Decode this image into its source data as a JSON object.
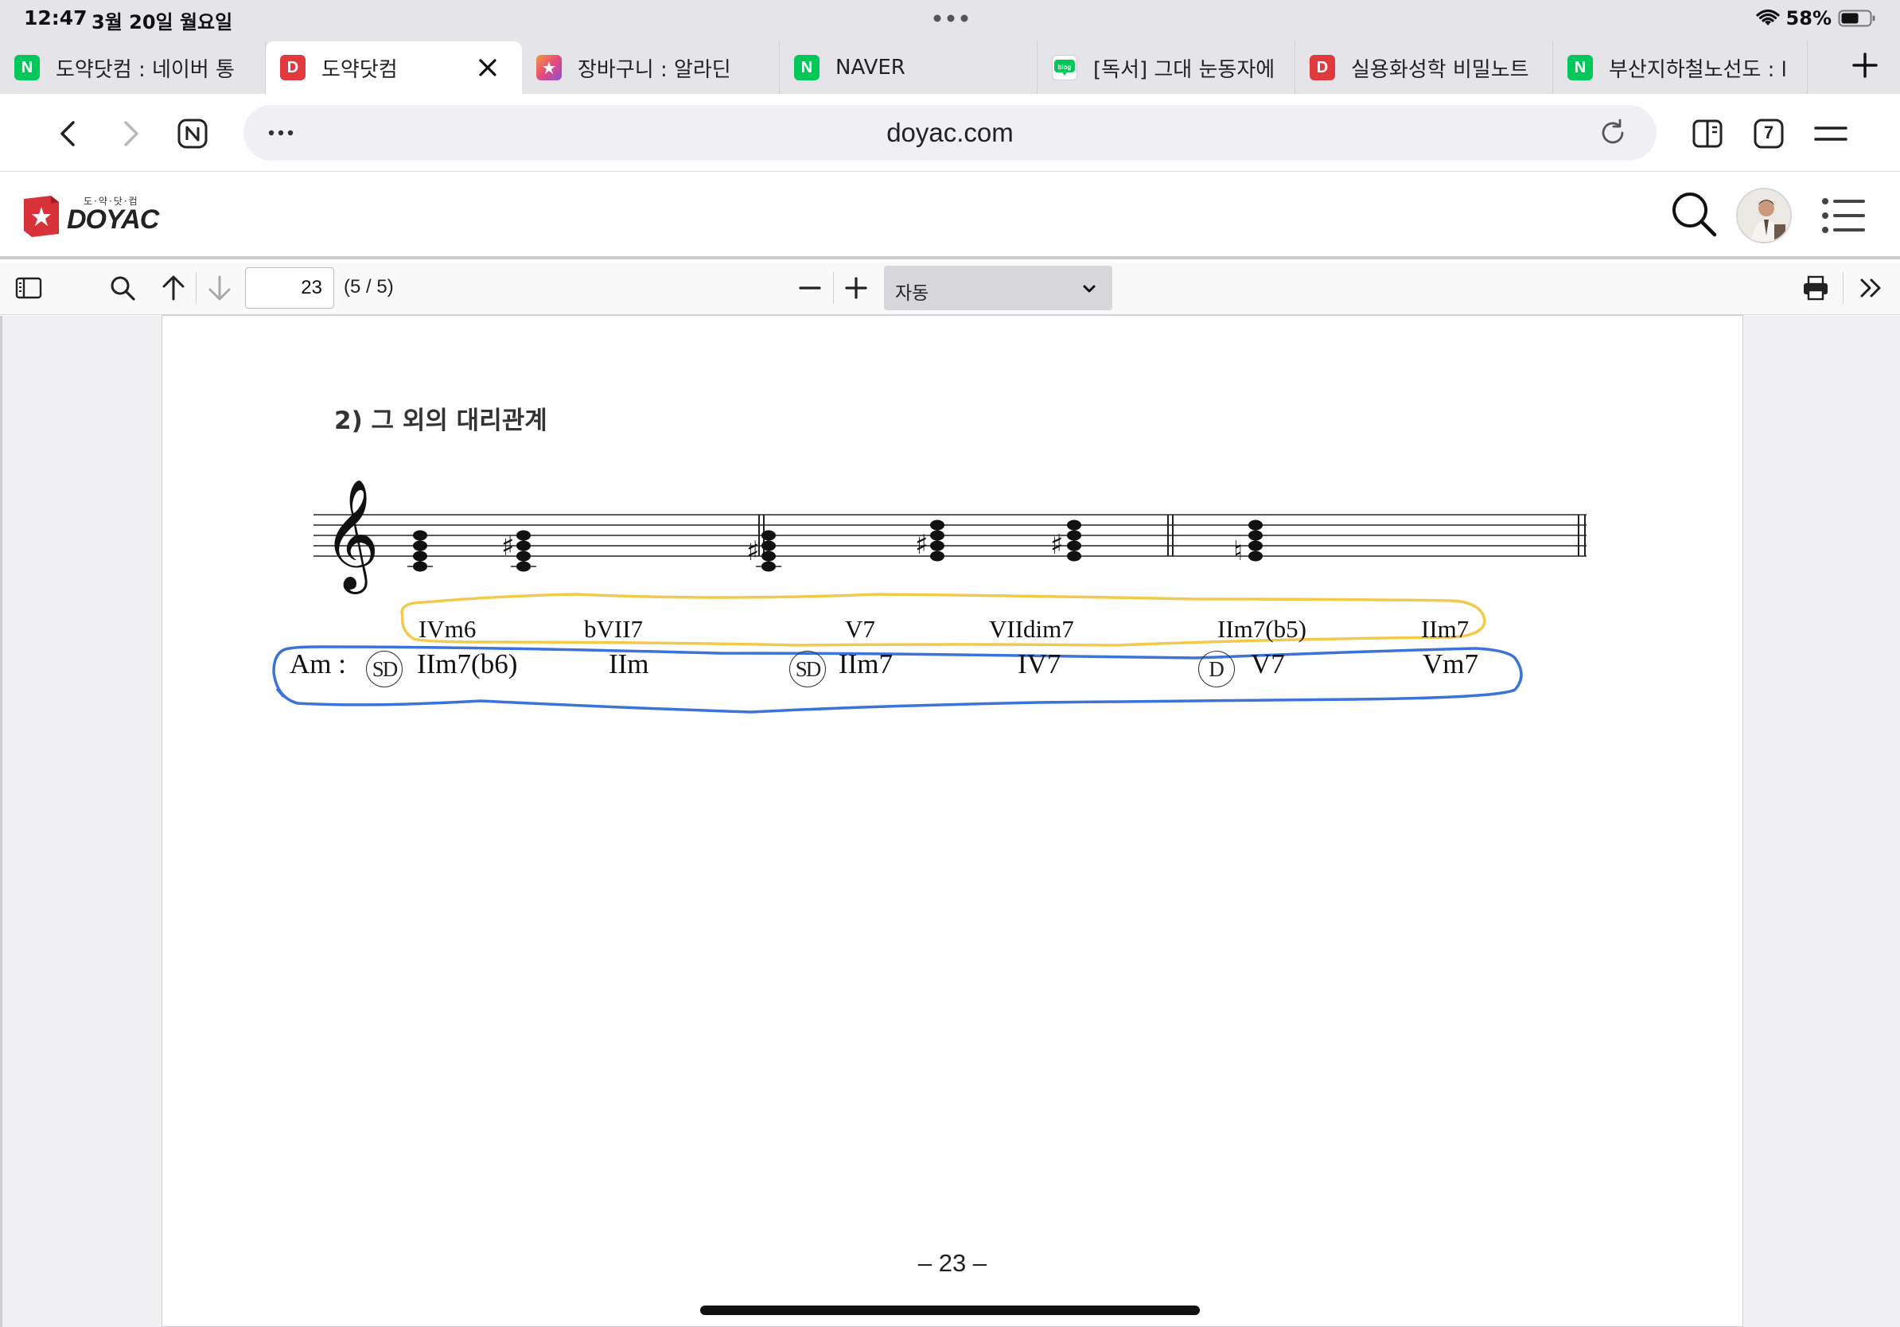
{
  "status": {
    "time": "12:47",
    "date": "3월 20일 월요일",
    "battery": "58%"
  },
  "tabs": [
    {
      "title": "도약닷컴 : 네이버 통",
      "favicon": "N",
      "favicon_color": "#03c75a",
      "active": false
    },
    {
      "title": "도약닷컴",
      "favicon": "D",
      "favicon_color": "#e03a3e",
      "active": true
    },
    {
      "title": "장바구니 : 알라딘",
      "favicon": "aladin-icon",
      "favicon_color": "#e84a7a",
      "active": false
    },
    {
      "title": "NAVER",
      "favicon": "N",
      "favicon_color": "#03c75a",
      "active": false
    },
    {
      "title": "[독서] 그대 눈동자에",
      "favicon": "blog",
      "favicon_color": "#03c75a",
      "active": false
    },
    {
      "title": "실용화성학 비밀노트",
      "favicon": "D",
      "favicon_color": "#e03a3e",
      "active": false
    },
    {
      "title": "부산지하철노선도 : l",
      "favicon": "N",
      "favicon_color": "#03c75a",
      "active": false
    }
  ],
  "address": {
    "url": "doyac.com",
    "tab_count": "7"
  },
  "site": {
    "logo_small": "도·약·닷·컴",
    "logo_text": "DOYAC"
  },
  "pdf_toolbar": {
    "page_number": "23",
    "page_count": "(5 / 5)",
    "zoom": "자동"
  },
  "document": {
    "section_title": "2) 그 외의 대리관계",
    "upper_chords": [
      "IVm6",
      "bVII7",
      "V7",
      "VIIdim7",
      "IIm7(b5)",
      "IIm7"
    ],
    "key_label": "Am :",
    "lower_chords": [
      "IIm7(b6)",
      "IIm",
      "IIm7",
      "IV7",
      "V7",
      "Vm7"
    ],
    "function_marks": [
      "SD",
      "SD",
      "D"
    ],
    "page_number": "– 23 –"
  },
  "colors": {
    "yellow_outline": "#f2c94c",
    "blue_outline": "#3b73d9",
    "doyac_red": "#d8333a"
  }
}
